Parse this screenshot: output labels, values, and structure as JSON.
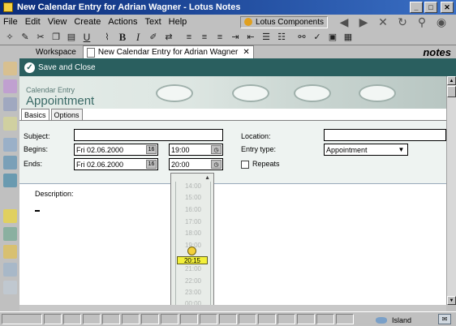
{
  "window": {
    "title": "New Calendar Entry for Adrian Wagner - Lotus Notes",
    "controls": [
      "_",
      "□",
      "✕"
    ]
  },
  "menu": {
    "items": [
      "File",
      "Edit",
      "View",
      "Create",
      "Actions",
      "Text",
      "Help"
    ],
    "location_combo": "Lotus Components"
  },
  "tabs": {
    "workspace": "Workspace",
    "document": "New Calendar Entry for Adrian Wagner",
    "brand": "notes"
  },
  "actionbar": {
    "save_close": "Save and Close"
  },
  "banner": {
    "category": "Calendar Entry",
    "title": "Appointment"
  },
  "subtabs": [
    "Basics",
    "Options"
  ],
  "form": {
    "subject_label": "Subject:",
    "subject_value": "",
    "begins_label": "Begins:",
    "begins_date": "Fri 02.06.2000",
    "begins_time": "19:00",
    "ends_label": "Ends:",
    "ends_date": "Fri 02.06.2000",
    "ends_time": "20:00",
    "location_label": "Location:",
    "location_value": "",
    "entry_type_label": "Entry type:",
    "entry_type_value": "Appointment",
    "repeats_label": "Repeats",
    "calendar_btn": "16",
    "description_label": "Description:"
  },
  "timepicker": {
    "times": [
      "14:00",
      "15:00",
      "16:00",
      "17:00",
      "18:00",
      "19:00",
      "21:00",
      "22:00",
      "23:00",
      "00:00"
    ],
    "selected": "20:15"
  },
  "statusbar": {
    "location": "Island"
  }
}
